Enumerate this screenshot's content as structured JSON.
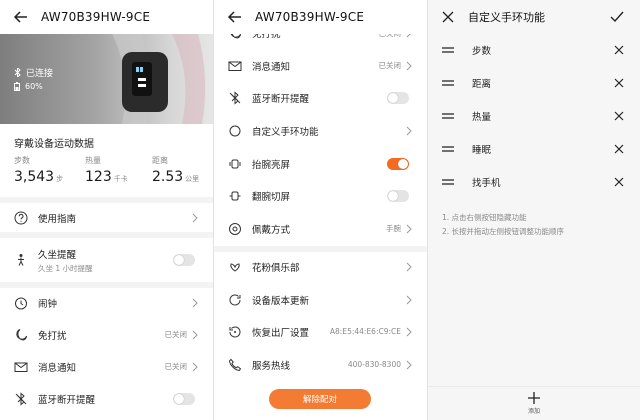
{
  "panel1": {
    "header": {
      "title": "AW70B39HW-9CE"
    },
    "device": {
      "status": "已连接",
      "battery": "60%"
    },
    "card": {
      "title": "穿戴设备运动数据",
      "stats": [
        {
          "label": "步数",
          "value": "3,543",
          "unit": "步"
        },
        {
          "label": "热量",
          "value": "123",
          "unit": "千卡"
        },
        {
          "label": "距离",
          "value": "2.53",
          "unit": "公里"
        }
      ]
    },
    "items": {
      "guide": {
        "label": "使用指南",
        "icon": "help-icon"
      },
      "sedentary": {
        "label": "久坐提醒",
        "sub": "久坐 1 小时提醒",
        "icon": "sedentary-icon",
        "on": false
      },
      "alarm": {
        "label": "闹钟",
        "icon": "alarm-icon"
      },
      "dnd": {
        "label": "免打扰",
        "value": "已关闭",
        "icon": "moon-icon"
      },
      "msg": {
        "label": "消息通知",
        "value": "已关闭",
        "icon": "mail-icon"
      },
      "bt": {
        "label": "蓝牙断开提醒",
        "icon": "bluetooth-off-icon",
        "on": false
      }
    }
  },
  "panel2": {
    "header": {
      "title": "AW70B39HW-9CE"
    },
    "items": {
      "dnd_partial": {
        "label": "免打扰",
        "value": "已关闭"
      },
      "msg": {
        "label": "消息通知",
        "value": "已关闭"
      },
      "bt": {
        "label": "蓝牙断开提醒",
        "on": false
      },
      "custom": {
        "label": "自定义手环功能"
      },
      "raise": {
        "label": "抬腕亮屏",
        "on": true
      },
      "flip": {
        "label": "翻腕切屏",
        "on": false
      },
      "wear": {
        "label": "佩戴方式",
        "value": "手腕"
      },
      "club": {
        "label": "花粉俱乐部"
      },
      "update": {
        "label": "设备版本更新"
      },
      "reset": {
        "label": "恢复出厂设置",
        "value": "A8:E5:44:E6:C9:CE"
      },
      "hotline": {
        "label": "服务热线",
        "value": "400-830-8300"
      }
    },
    "unbind_label": "解除配对"
  },
  "panel3": {
    "title": "自定义手环功能",
    "functions": [
      "步数",
      "距离",
      "热量",
      "睡眠",
      "找手机"
    ],
    "notes": [
      "1. 点击右侧按钮隐藏功能",
      "2. 长按并拖动左侧按钮调整功能顺序"
    ],
    "add_label": "添加"
  },
  "colors": {
    "accent": "#f36b21",
    "toggle_off": "#e4e4e4",
    "divider": "#f3f3f3"
  }
}
